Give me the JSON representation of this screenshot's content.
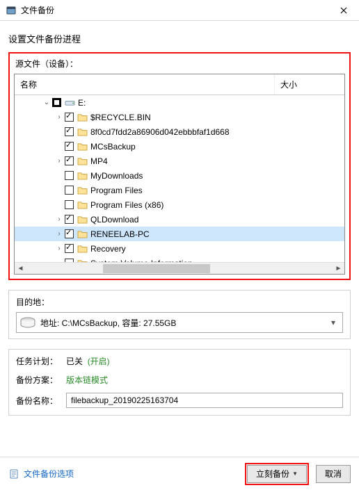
{
  "title": "文件备份",
  "heading": "设置文件备份进程",
  "source": {
    "label": "源文件（设备）：",
    "col_name": "名称",
    "col_size": "大小",
    "root": "E:",
    "items": [
      {
        "label": "$RECYCLE.BIN",
        "checked": true,
        "expandable": true
      },
      {
        "label": "8f0cd7fdd2a86906d042ebbbfaf1d668",
        "checked": true,
        "expandable": false
      },
      {
        "label": "MCsBackup",
        "checked": true,
        "expandable": false
      },
      {
        "label": "MP4",
        "checked": true,
        "expandable": true
      },
      {
        "label": "MyDownloads",
        "checked": false,
        "expandable": false
      },
      {
        "label": "Program Files",
        "checked": false,
        "expandable": false
      },
      {
        "label": "Program Files (x86)",
        "checked": false,
        "expandable": false
      },
      {
        "label": "QLDownload",
        "checked": true,
        "expandable": true
      },
      {
        "label": "RENEELAB-PC",
        "checked": true,
        "expandable": true,
        "selected": true
      },
      {
        "label": "Recovery",
        "checked": true,
        "expandable": true
      },
      {
        "label": "System Volume Information",
        "checked": false,
        "expandable": false
      }
    ]
  },
  "dest": {
    "label": "目的地：",
    "text": "地址: C:\\MCsBackup, 容量: 27.55GB"
  },
  "task": {
    "plan_k": "任务计划：",
    "plan_v": "已关",
    "plan_toggle": "(开启)",
    "scheme_k": "备份方案：",
    "scheme_v": "版本链模式",
    "name_k": "备份名称：",
    "name_v": "filebackup_20190225163704"
  },
  "footer": {
    "options": "文件备份选项",
    "primary": "立刻备份",
    "cancel": "取消"
  }
}
